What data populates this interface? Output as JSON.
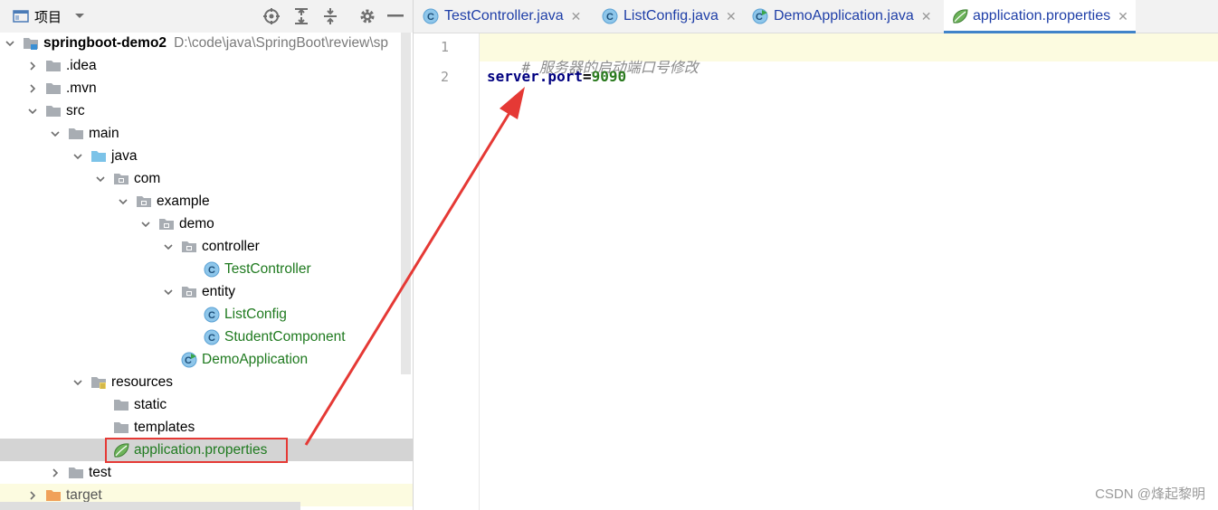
{
  "project_toolbar": {
    "title": "项目",
    "icons": [
      "project-view-icon",
      "dropdown-icon",
      "locate-icon",
      "expand-all-icon",
      "collapse-all-icon",
      "settings-icon",
      "hide-icon"
    ]
  },
  "tree": [
    {
      "label": "springboot-demo2",
      "path": "D:\\code\\java\\SpringBoot\\review\\sp",
      "expanded": true,
      "icon": "module-folder-icon"
    },
    {
      "label": ".idea",
      "expanded": false,
      "icon": "folder-icon"
    },
    {
      "label": ".mvn",
      "expanded": false,
      "icon": "folder-icon"
    },
    {
      "label": "src",
      "expanded": true,
      "icon": "folder-icon"
    },
    {
      "label": "main",
      "expanded": true,
      "icon": "folder-icon"
    },
    {
      "label": "java",
      "expanded": true,
      "icon": "source-folder-icon"
    },
    {
      "label": "com",
      "expanded": true,
      "icon": "package-icon"
    },
    {
      "label": "example",
      "expanded": true,
      "icon": "package-icon"
    },
    {
      "label": "demo",
      "expanded": true,
      "icon": "package-icon"
    },
    {
      "label": "controller",
      "expanded": true,
      "icon": "package-icon"
    },
    {
      "label": "TestController",
      "icon": "class-icon"
    },
    {
      "label": "entity",
      "expanded": true,
      "icon": "package-icon"
    },
    {
      "label": "ListConfig",
      "icon": "class-icon"
    },
    {
      "label": "StudentComponent",
      "icon": "class-icon"
    },
    {
      "label": "DemoApplication",
      "icon": "spring-boot-class-icon"
    },
    {
      "label": "resources",
      "expanded": true,
      "icon": "resources-folder-icon"
    },
    {
      "label": "static",
      "icon": "folder-icon"
    },
    {
      "label": "templates",
      "icon": "folder-icon"
    },
    {
      "label": "application.properties",
      "icon": "spring-properties-icon",
      "selected": true
    },
    {
      "label": "test",
      "expanded": false,
      "icon": "folder-icon"
    },
    {
      "label": "target",
      "expanded": false,
      "icon": "excluded-folder-icon"
    }
  ],
  "tabs": [
    {
      "label": "TestController.java",
      "icon": "class-icon"
    },
    {
      "label": "ListConfig.java",
      "icon": "class-icon"
    },
    {
      "label": "DemoApplication.java",
      "icon": "spring-boot-class-icon"
    },
    {
      "label": "application.properties",
      "icon": "spring-properties-icon",
      "active": true
    }
  ],
  "editor": {
    "line_numbers": [
      "1",
      "2"
    ],
    "comment": "# 服务器的启动端口号修改",
    "key": "server.port",
    "equals": "=",
    "value": "9090"
  },
  "watermark": "CSDN @烽起黎明",
  "colors": {
    "selection": "#d4d4d4",
    "caret_line": "#fcfbe0",
    "tab_active_underline": "#4083c9",
    "annotation": "#e53935"
  }
}
